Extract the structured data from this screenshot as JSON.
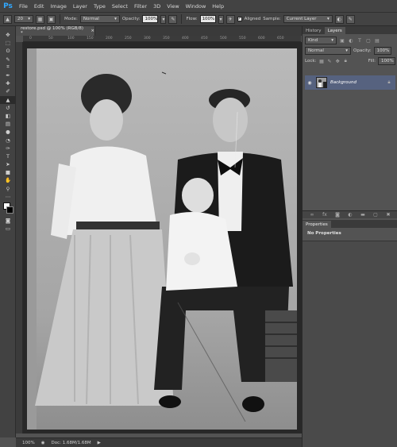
{
  "app": {
    "logo": "Ps"
  },
  "menu": [
    "File",
    "Edit",
    "Image",
    "Layer",
    "Type",
    "Select",
    "Filter",
    "3D",
    "View",
    "Window",
    "Help"
  ],
  "options": {
    "brush_size": "20",
    "mode_label": "Mode:",
    "mode_value": "Normal",
    "opacity_label": "Opacity:",
    "opacity_value": "100%",
    "flow_label": "Flow:",
    "flow_value": "100%",
    "aligned_label": "Aligned",
    "sample_label": "Sample:",
    "sample_value": "Current Layer"
  },
  "document": {
    "tab_title": "restore.psd @ 100% (RGB/8) *",
    "close_glyph": "×"
  },
  "ruler": {
    "top_ticks": [
      "0",
      "50",
      "100",
      "150",
      "200",
      "250",
      "300",
      "350",
      "400",
      "450",
      "500",
      "550",
      "600",
      "650"
    ]
  },
  "status": {
    "zoom": "100%",
    "doc_size": "Doc: 1.68M/1.68M"
  },
  "layers_panel": {
    "tabs": [
      "History",
      "Layers"
    ],
    "active_tab": "Layers",
    "kind_filter": "Kind",
    "blend_mode": "Normal",
    "opacity_label": "Opacity:",
    "opacity_value": "100%",
    "lock_label": "Lock:",
    "fill_label": "Fill:",
    "fill_value": "100%",
    "layer_name": "Background"
  },
  "properties_panel": {
    "tab": "Properties",
    "message": "No Properties"
  },
  "colors": {
    "chrome_dark": "#434343",
    "canvas_bg": "#282828",
    "panel_bg": "#535353",
    "selected_layer": "#56627f",
    "ps_blue": "#31a8ff"
  }
}
